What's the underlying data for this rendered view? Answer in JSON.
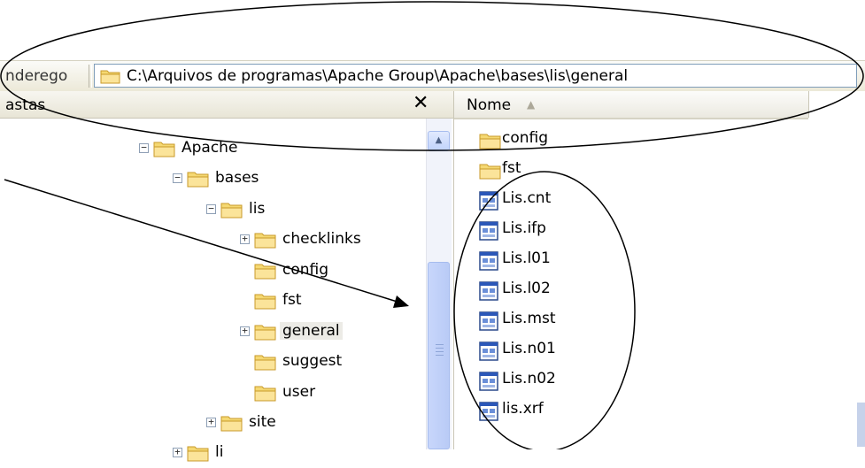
{
  "address_bar": {
    "label": "nderego",
    "path": "C:\\Arquivos de programas\\Apache Group\\Apache\\bases\\lis\\general"
  },
  "folders_pane": {
    "title": "astas",
    "close_glyph": "✕",
    "tree": [
      {
        "label": "Apache",
        "expander": "−",
        "selected": false
      },
      {
        "label": "bases",
        "expander": "−",
        "selected": false
      },
      {
        "label": "lis",
        "expander": "−",
        "selected": false
      },
      {
        "label": "checklinks",
        "expander": "+",
        "selected": false
      },
      {
        "label": "config",
        "expander": "",
        "selected": false
      },
      {
        "label": "fst",
        "expander": "",
        "selected": false
      },
      {
        "label": "general",
        "expander": "+",
        "selected": true
      },
      {
        "label": "suggest",
        "expander": "",
        "selected": false
      },
      {
        "label": "user",
        "expander": "",
        "selected": false
      },
      {
        "label": "site",
        "expander": "+",
        "selected": false
      },
      {
        "label": "li",
        "expander": "+",
        "selected": false
      }
    ],
    "scroll_up_glyph": "▲"
  },
  "files_pane": {
    "column_header": "Nome",
    "sort_glyph": "▲",
    "items": [
      {
        "name": "config",
        "type": "folder"
      },
      {
        "name": "fst",
        "type": "folder"
      },
      {
        "name": "Lis.cnt",
        "type": "file"
      },
      {
        "name": "Lis.ifp",
        "type": "file"
      },
      {
        "name": "Lis.l01",
        "type": "file"
      },
      {
        "name": "Lis.l02",
        "type": "file"
      },
      {
        "name": "Lis.mst",
        "type": "file"
      },
      {
        "name": "Lis.n01",
        "type": "file"
      },
      {
        "name": "Lis.n02",
        "type": "file"
      },
      {
        "name": "lis.xrf",
        "type": "file"
      }
    ]
  },
  "icons": {
    "folder": "folder-icon",
    "file": "document-icon",
    "expander": "tree-expander-icon",
    "close": "close-icon"
  },
  "colors": {
    "folder_fill": "#f5d872",
    "folder_edge": "#c89a2a",
    "address_border": "#7f9db9",
    "scroll_thumb": "#c1d1f8",
    "annotation_stroke": "#000000"
  }
}
